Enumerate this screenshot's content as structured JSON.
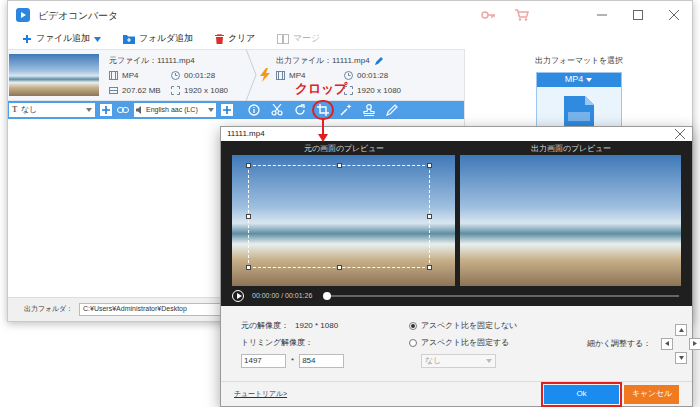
{
  "main_window": {
    "title": "ビデオコンバータ",
    "toolbar": [
      {
        "label": "ファイル追加",
        "disabled": false
      },
      {
        "label": "フォルダ追加",
        "disabled": false
      },
      {
        "label": "クリア",
        "disabled": false
      },
      {
        "label": "マージ",
        "disabled": true
      }
    ],
    "source": {
      "name": "元ファイル：11111.mp4",
      "format": "MP4",
      "duration": "00:01:28",
      "size": "207.62 MB",
      "resolution": "1920 x 1080"
    },
    "output": {
      "name": "出力ファイル：11111.mp4",
      "format": "MP4",
      "duration": "00:01:28",
      "resolution": "1920 x 1080"
    },
    "edit_bar": {
      "subtitle_icon": "T",
      "subtitle": "なし",
      "audio": "English aac (LC)"
    },
    "format_panel": {
      "title": "出力フォーマットを選択",
      "format": "MP4"
    },
    "output_folder": {
      "label": "出力フォルダ：",
      "path": "C:¥Users¥Administrator¥Desktop"
    }
  },
  "annotation": {
    "label": "クロップ"
  },
  "dialog": {
    "title": "11111.mp4",
    "previews": [
      "元の画面のプレビュー",
      "出力画面のプレビュー"
    ],
    "player": {
      "time": "00:00:00 / 00:01:26",
      "level": 0
    },
    "original_resolution": {
      "label": "元の解像度：",
      "value": "1920 * 1080"
    },
    "trim_resolution": {
      "label": "トリミング解像度：",
      "width": "1497",
      "separator": "*",
      "height": "854"
    },
    "aspect_options": [
      {
        "label": "アスペクト比を固定しない",
        "selected": true
      },
      {
        "label": "アスペクト比を固定する",
        "selected": false
      }
    ],
    "aspect_preset": {
      "value": "なし",
      "disabled": true
    },
    "fine_tune": {
      "label": "細かく調整する："
    },
    "tutorial": "チュートリアル>",
    "buttons": [
      {
        "label": "Ok",
        "highlighted": true
      },
      {
        "label": "キャンセル",
        "highlighted": false
      }
    ]
  }
}
